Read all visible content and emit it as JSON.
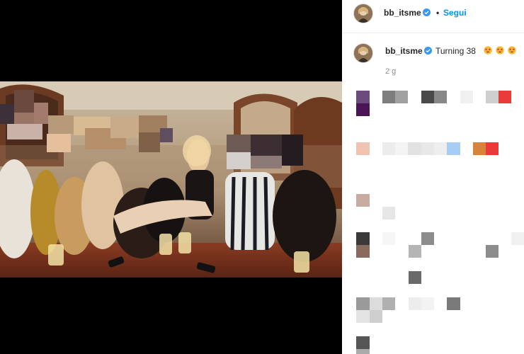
{
  "post": {
    "username": "bb_itsme",
    "separator": "•",
    "follow_label": "Segui",
    "caption_text": "Turning 38",
    "caption_emojis": [
      "star-struck-emoji",
      "star-struck-emoji",
      "star-struck-emoji"
    ],
    "time_ago": "2 g"
  },
  "colors": {
    "follow_blue": "#0095f6",
    "verified_blue": "#3897f0",
    "text_dark": "#262626",
    "text_muted": "#8e8e8e"
  }
}
